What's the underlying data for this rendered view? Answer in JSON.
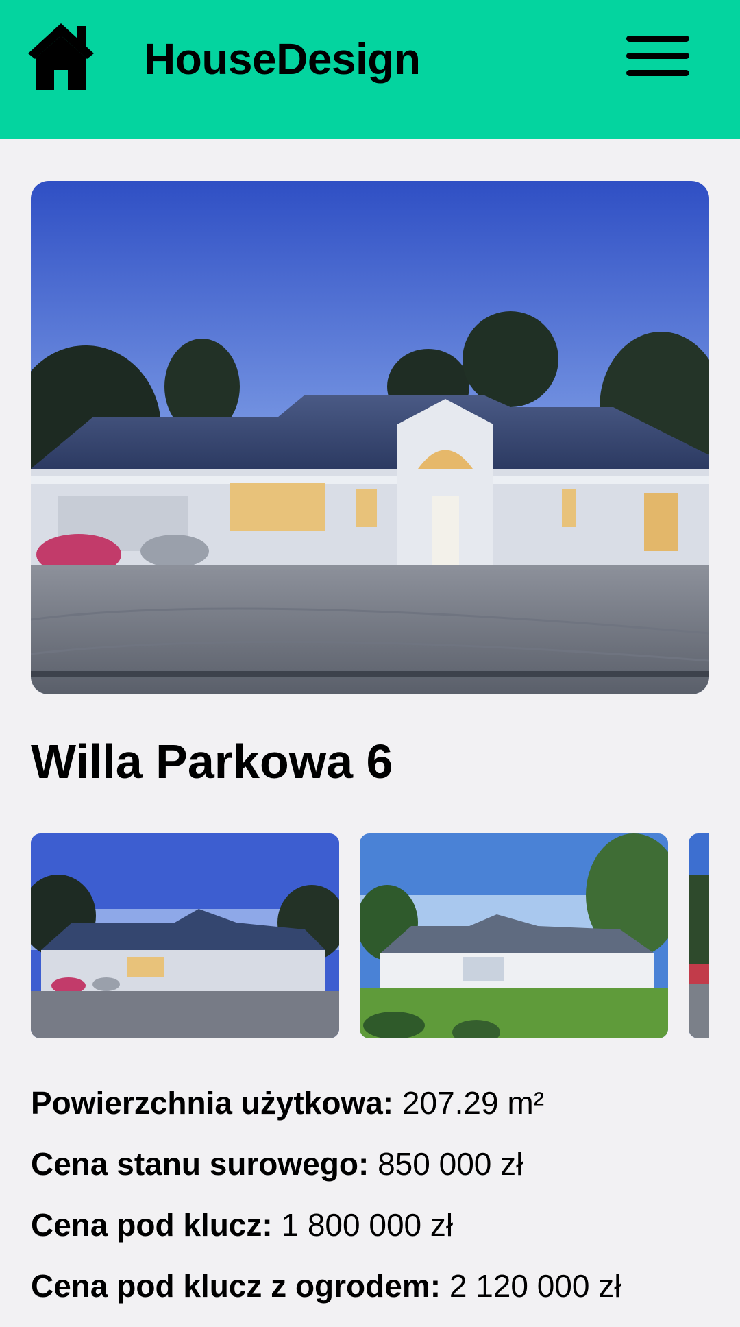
{
  "header": {
    "app_title": "HouseDesign",
    "home_icon": "home-icon",
    "menu_icon": "hamburger-menu-icon",
    "background_color": "#04d49f"
  },
  "house": {
    "title": "Willa Parkowa 6"
  },
  "gallery": {
    "images": [
      "night-render-front",
      "day-render-garden",
      "render-partial"
    ]
  },
  "details": [
    {
      "label": "Powierzchnia użytkowa:",
      "value": "207.29 m²"
    },
    {
      "label": "Cena stanu surowego:",
      "value": "850 000 zł"
    },
    {
      "label": "Cena pod klucz:",
      "value": "1 800 000 zł"
    },
    {
      "label": "Cena pod klucz z ogrodem:",
      "value": "2 120 000 zł"
    }
  ]
}
